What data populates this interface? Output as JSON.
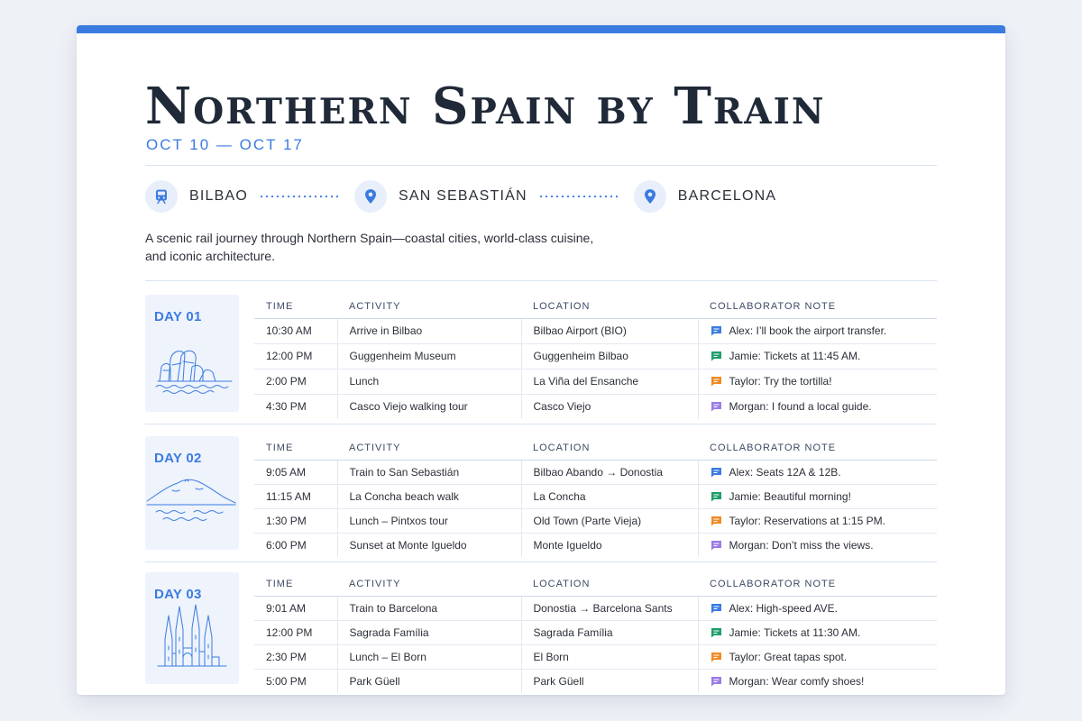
{
  "title": "Northern Spain by Train",
  "dates": "OCT 10 — OCT 17",
  "route": [
    {
      "label": "BILBAO",
      "icon": "train-icon"
    },
    {
      "label": "SAN SEBASTIÁN",
      "icon": "map-pin-icon"
    },
    {
      "label": "BARCELONA",
      "icon": "map-pin-icon"
    }
  ],
  "description": "A scenic rail journey through Northern Spain—coastal cities, world-class cuisine, and iconic architecture.",
  "columns": {
    "time": "TIME",
    "activity": "ACTIVITY",
    "location": "LOCATION",
    "note": "COLLABORATOR NOTE"
  },
  "note_colors": {
    "Alex": "#3b7be0",
    "Jamie": "#1f9d6b",
    "Taylor": "#f08a24",
    "Morgan": "#9b7be8"
  },
  "days": [
    {
      "label": "DAY 01",
      "illustration": "guggenheim-illustration",
      "rows": [
        {
          "time": "10:30 AM",
          "activity": "Arrive in Bilbao",
          "location": "Bilbao Airport (BIO)",
          "note": "Alex: I’ll book the airport transfer.",
          "author": "Alex"
        },
        {
          "time": "12:00 PM",
          "activity": "Guggenheim Museum",
          "location": "Guggenheim Bilbao",
          "note": "Jamie: Tickets at 11:45 AM.",
          "author": "Jamie"
        },
        {
          "time": "2:00 PM",
          "activity": "Lunch",
          "location": "La Viña del Ensanche",
          "note": "Taylor: Try the tortilla!",
          "author": "Taylor"
        },
        {
          "time": "4:30 PM",
          "activity": "Casco Viejo walking tour",
          "location": "Casco Viejo",
          "note": "Morgan: I found a local guide.",
          "author": "Morgan"
        }
      ]
    },
    {
      "label": "DAY 02",
      "illustration": "concha-bay-illustration",
      "rows": [
        {
          "time": "9:05 AM",
          "activity": "Train to San Sebastián",
          "location": "Bilbao Abando → Donostia",
          "note": "Alex: Seats 12A & 12B.",
          "author": "Alex"
        },
        {
          "time": "11:15 AM",
          "activity": "La Concha beach walk",
          "location": "La Concha",
          "note": "Jamie: Beautiful morning!",
          "author": "Jamie"
        },
        {
          "time": "1:30 PM",
          "activity": "Lunch – Pintxos tour",
          "location": "Old Town (Parte Vieja)",
          "note": "Taylor: Reservations at 1:15 PM.",
          "author": "Taylor"
        },
        {
          "time": "6:00 PM",
          "activity": "Sunset at Monte Igueldo",
          "location": "Monte Igueldo",
          "note": "Morgan: Don’t miss the views.",
          "author": "Morgan"
        }
      ]
    },
    {
      "label": "DAY 03",
      "illustration": "sagrada-familia-illustration",
      "rows": [
        {
          "time": "9:01 AM",
          "activity": "Train to Barcelona",
          "location": "Donostia → Barcelona Sants",
          "note": "Alex: High-speed AVE.",
          "author": "Alex"
        },
        {
          "time": "12:00 PM",
          "activity": "Sagrada Família",
          "location": "Sagrada Família",
          "note": "Jamie: Tickets at 11:30 AM.",
          "author": "Jamie"
        },
        {
          "time": "2:30 PM",
          "activity": "Lunch – El Born",
          "location": "El Born",
          "note": "Taylor: Great tapas spot.",
          "author": "Taylor"
        },
        {
          "time": "5:00 PM",
          "activity": "Park Güell",
          "location": "Park Güell",
          "note": "Morgan: Wear comfy shoes!",
          "author": "Morgan"
        }
      ]
    }
  ]
}
